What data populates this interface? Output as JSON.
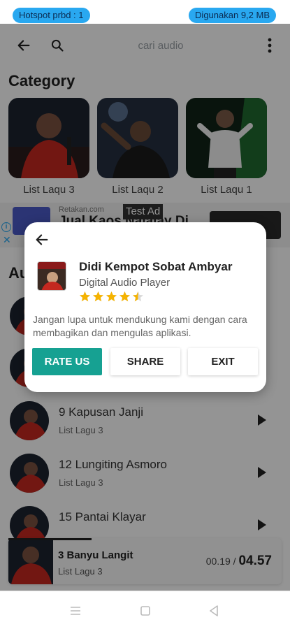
{
  "status_bar": {
    "left_pill": "Hotspot prbd : 1",
    "right_pill": "Digunakan 9,2 MB"
  },
  "toolbar": {
    "back_icon": "arrow-left-icon",
    "search_icon": "search-icon",
    "search_placeholder": "cari audio",
    "menu_icon": "more-vert-icon"
  },
  "category": {
    "title": "Category",
    "items": [
      {
        "label": "List Laqu 3"
      },
      {
        "label": "List Laqu 2"
      },
      {
        "label": "List Laqu 1"
      }
    ]
  },
  "ad": {
    "badge": "Test Ad",
    "source": "Retakan.com",
    "headline": "Jual Kaos Nalalay Di"
  },
  "list_section": {
    "title_partial": "Au"
  },
  "songs": [
    {
      "title": "9 Kapusan Janji",
      "subtitle": "List Lagu 3"
    },
    {
      "title": "12 Lungiting Asmoro",
      "subtitle": "List Lagu 3"
    },
    {
      "title": "15 Pantai Klayar",
      "subtitle": "List Lagu 3"
    }
  ],
  "player": {
    "title": "3 Banyu Langit",
    "subtitle": "List Lagu 3",
    "elapsed": "00.19",
    "separator": " / ",
    "total": "04.57"
  },
  "dialog": {
    "back_icon": "arrow-left-icon",
    "app_name": "Didi Kempot Sobat Ambyar",
    "app_category": "Digital Audio Player",
    "rating": 4.5,
    "message": "Jangan lupa untuk mendukung kami dengan cara membagikan dan mengulas aplikasi.",
    "rate_label": "RATE US",
    "share_label": "SHARE",
    "exit_label": "EXIT",
    "rate_color": "#16a192"
  },
  "colors": {
    "pill": "#29a8f0",
    "overlay": "rgba(0,0,0,0.42)"
  }
}
